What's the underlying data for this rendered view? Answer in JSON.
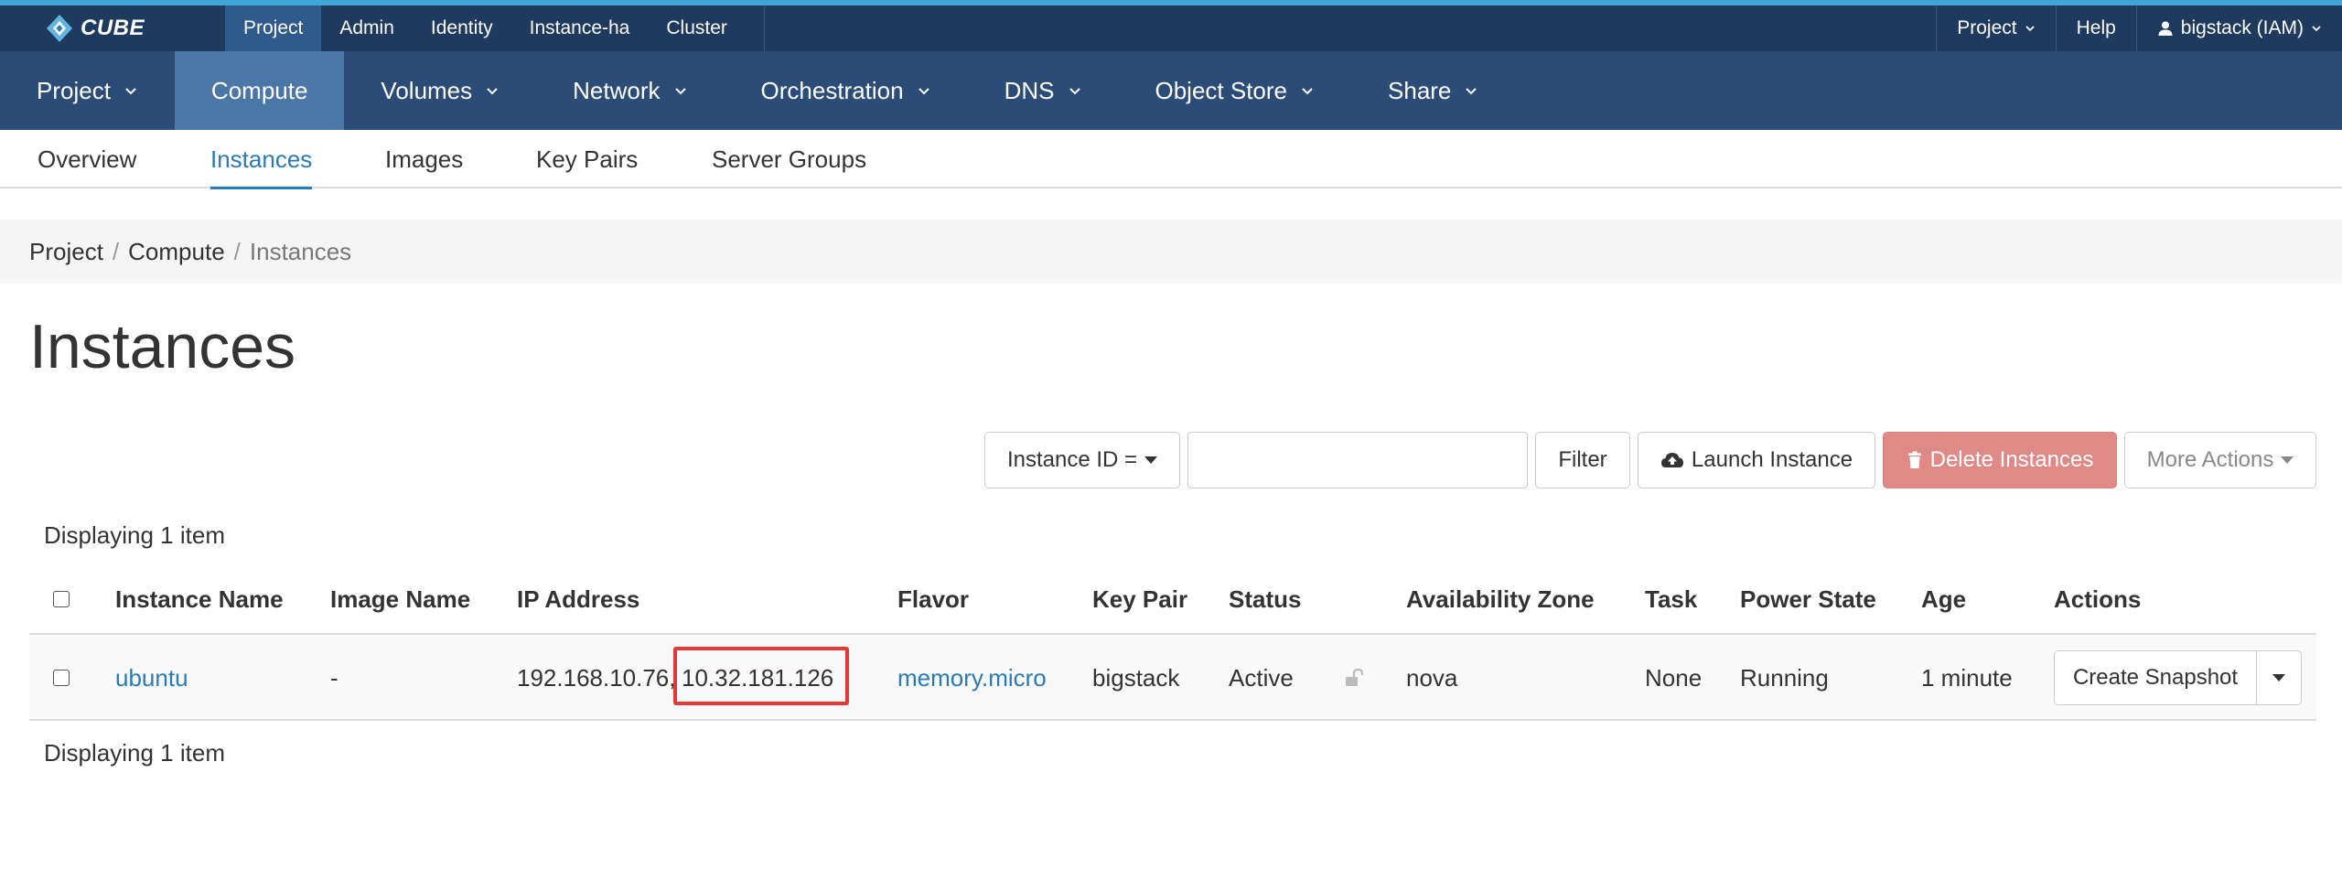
{
  "brand": {
    "name": "CUBE"
  },
  "topnav": {
    "items": [
      {
        "label": "Project",
        "active": true
      },
      {
        "label": "Admin"
      },
      {
        "label": "Identity"
      },
      {
        "label": "Instance-ha"
      },
      {
        "label": "Cluster"
      }
    ],
    "right": {
      "project_label": "Project",
      "help_label": "Help",
      "user_label": "bigstack (IAM)"
    }
  },
  "mainnav": {
    "items": [
      {
        "label": "Project",
        "dropdown": true
      },
      {
        "label": "Compute",
        "active": true
      },
      {
        "label": "Volumes",
        "dropdown": true
      },
      {
        "label": "Network",
        "dropdown": true
      },
      {
        "label": "Orchestration",
        "dropdown": true
      },
      {
        "label": "DNS",
        "dropdown": true
      },
      {
        "label": "Object Store",
        "dropdown": true
      },
      {
        "label": "Share",
        "dropdown": true
      }
    ]
  },
  "subnav": {
    "items": [
      {
        "label": "Overview"
      },
      {
        "label": "Instances",
        "active": true
      },
      {
        "label": "Images"
      },
      {
        "label": "Key Pairs"
      },
      {
        "label": "Server Groups"
      }
    ]
  },
  "breadcrumb": {
    "items": [
      "Project",
      "Compute",
      "Instances"
    ],
    "separator": "/"
  },
  "page": {
    "title": "Instances"
  },
  "toolbar": {
    "filter_field_label": "Instance ID =",
    "filter_input_value": "",
    "filter_button": "Filter",
    "launch_button": "Launch Instance",
    "delete_button": "Delete Instances",
    "more_actions_button": "More Actions"
  },
  "display_count": "Displaying 1 item",
  "table": {
    "columns": [
      "Instance Name",
      "Image Name",
      "IP Address",
      "Flavor",
      "Key Pair",
      "Status",
      "Availability Zone",
      "Task",
      "Power State",
      "Age",
      "Actions"
    ],
    "rows": [
      {
        "instance_name": "ubuntu",
        "image_name": "-",
        "ip_primary": "192.168.10.76,",
        "ip_secondary": "10.32.181.126",
        "flavor": "memory.micro",
        "key_pair": "bigstack",
        "status": "Active",
        "availability_zone": "nova",
        "task": "None",
        "power_state": "Running",
        "age": "1 minute",
        "action_label": "Create Snapshot"
      }
    ]
  },
  "colors": {
    "topbar": "#1f3a5f",
    "mainnav": "#2a4c77",
    "active_nav": "#4a76a8",
    "link": "#2a7ab5",
    "danger": "#e08a87",
    "highlight": "#e53935"
  }
}
